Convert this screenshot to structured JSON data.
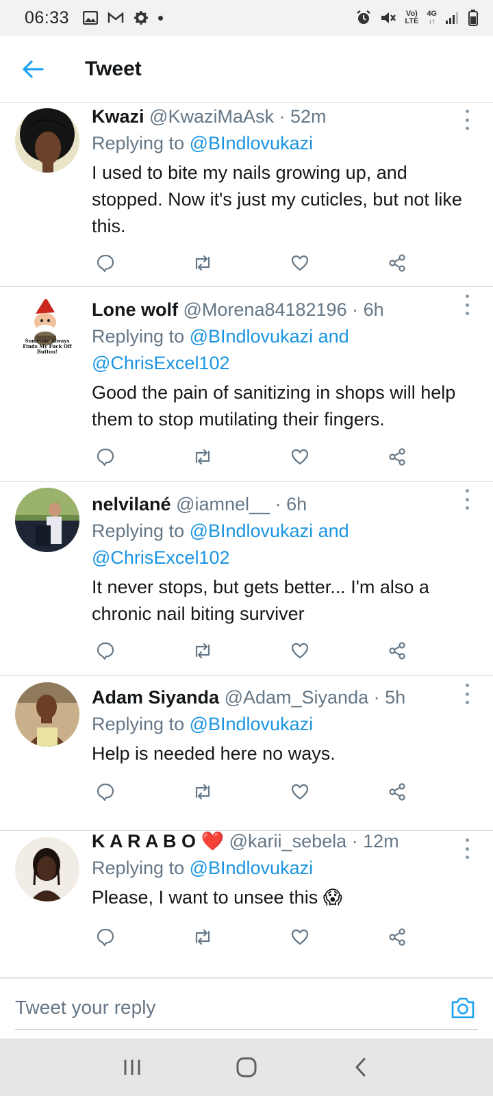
{
  "status_bar": {
    "time": "06:33",
    "network_label_top": "Vo)",
    "network_label_bottom": "LTE",
    "data_label": "4G"
  },
  "header": {
    "title": "Tweet"
  },
  "tweets": [
    {
      "name": "Kwazi",
      "handle": "@KwaziMaAsk",
      "time": "· 52m",
      "replying_prefix": "Replying to ",
      "mentions": "@BIndlovukazi",
      "text": "I used to bite my nails growing up, and stopped. Now it's just my cuticles, but not like this."
    },
    {
      "name": "Lone wolf",
      "handle": "@Morena84182196",
      "time": "· 6h",
      "replying_prefix": "Replying to ",
      "mentions": "@BIndlovukazi and @ChrisExcel102",
      "text": "Good the pain of sanitizing in shops will help them to stop mutilating their fingers.",
      "avatar_caption": "Someone Always Finds My Fuck Off Button!"
    },
    {
      "name": "nelvilané",
      "handle": "@iamnel__",
      "time": "· 6h",
      "replying_prefix": "Replying to ",
      "mentions": "@BIndlovukazi and @ChrisExcel102",
      "text": "It never stops, but gets better... I'm also a chronic nail biting surviver"
    },
    {
      "name": "Adam Siyanda",
      "handle": "@Adam_Siyanda",
      "time": "· 5h",
      "replying_prefix": "Replying to ",
      "mentions": "@BIndlovukazi",
      "text": "Help is needed here no ways."
    },
    {
      "name": "K A R A B O ❤️",
      "handle": "@karii_sebela",
      "time": "· 12m",
      "replying_prefix": "Replying to ",
      "mentions": "@BIndlovukazi",
      "text": "Please, I want to unsee this 😱"
    }
  ],
  "reply_bar": {
    "placeholder": "Tweet your reply"
  },
  "icons": {
    "back": "arrow-left-icon",
    "reply": "comment-icon",
    "retweet": "retweet-icon",
    "like": "heart-icon",
    "share": "share-icon",
    "camera": "camera-icon",
    "more": "more-vertical-icon"
  },
  "colors": {
    "accent": "#1da1f2",
    "mention": "#1b95e0",
    "secondary_text": "#657786",
    "primary_text": "#14171a"
  }
}
